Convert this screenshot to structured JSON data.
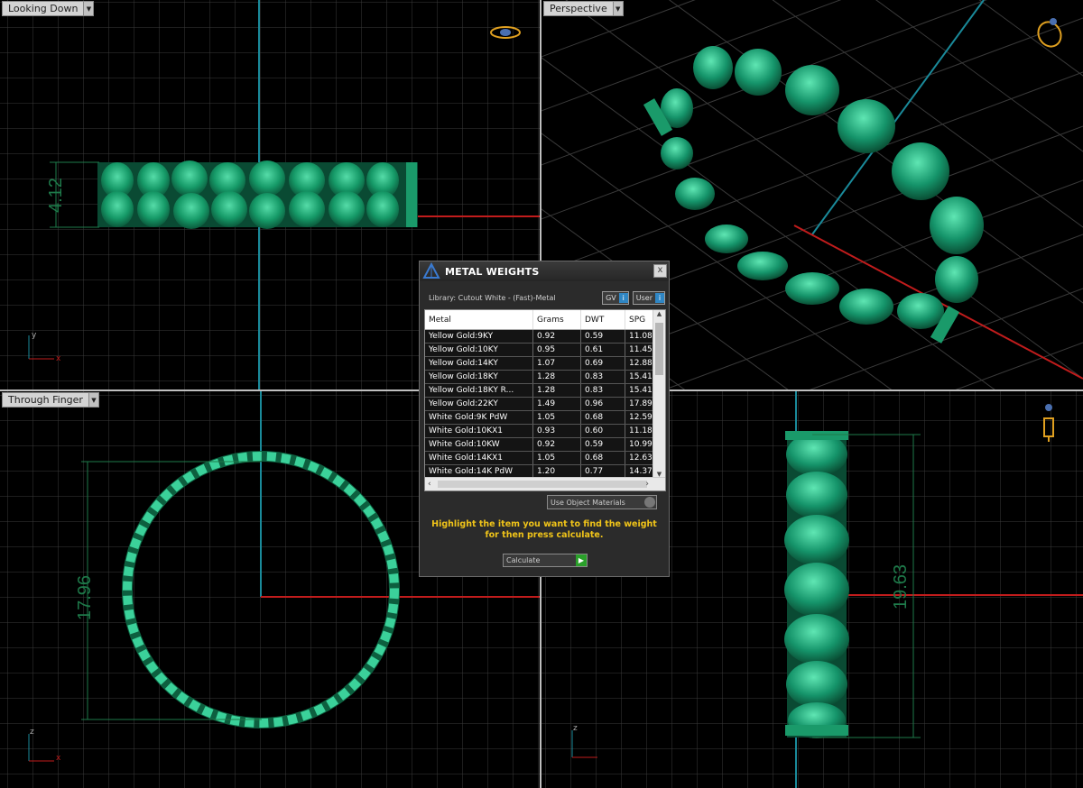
{
  "viewports": {
    "top": {
      "label": "Looking Down",
      "dimension": "4.12"
    },
    "perspective": {
      "label": "Perspective"
    },
    "finger": {
      "label": "Through Finger",
      "dimension": "17.96"
    },
    "side": {
      "dimension": "19.63"
    }
  },
  "axes": {
    "y": "y",
    "x": "x",
    "z": "z"
  },
  "dialog": {
    "title": "METAL WEIGHTS",
    "close": "x",
    "library": "Library: Cutout White - (Fast)-Metal",
    "toggle_gv": "GV",
    "toggle_user": "User",
    "toggle_key": "i",
    "columns": [
      "Metal",
      "Grams",
      "DWT",
      "SPG"
    ],
    "rows": [
      {
        "metal": "Yellow Gold:9KY",
        "grams": "0.92",
        "dwt": "0.59",
        "spg": "11.08"
      },
      {
        "metal": "Yellow Gold:10KY",
        "grams": "0.95",
        "dwt": "0.61",
        "spg": "11.45"
      },
      {
        "metal": "Yellow Gold:14KY",
        "grams": "1.07",
        "dwt": "0.69",
        "spg": "12.88"
      },
      {
        "metal": "Yellow Gold:18KY",
        "grams": "1.28",
        "dwt": "0.83",
        "spg": "15.41"
      },
      {
        "metal": "Yellow Gold:18KY R...",
        "grams": "1.28",
        "dwt": "0.83",
        "spg": "15.41"
      },
      {
        "metal": "Yellow Gold:22KY",
        "grams": "1.49",
        "dwt": "0.96",
        "spg": "17.89"
      },
      {
        "metal": "White Gold:9K PdW",
        "grams": "1.05",
        "dwt": "0.68",
        "spg": "12.59"
      },
      {
        "metal": "White Gold:10KX1",
        "grams": "0.93",
        "dwt": "0.60",
        "spg": "11.18"
      },
      {
        "metal": "White Gold:10KW",
        "grams": "0.92",
        "dwt": "0.59",
        "spg": "10.99"
      },
      {
        "metal": "White Gold:14KX1",
        "grams": "1.05",
        "dwt": "0.68",
        "spg": "12.63"
      },
      {
        "metal": "White Gold:14K PdW",
        "grams": "1.20",
        "dwt": "0.77",
        "spg": "14.37"
      }
    ],
    "use_object_materials": "Use Object Materials",
    "hint_line1": "Highlight the item you want to find the weight",
    "hint_line2": "for then press calculate.",
    "calculate": "Calculate",
    "calculate_key": "▶"
  },
  "colors": {
    "grid": "#3a3a3a",
    "gem_green": "#1a9a6a",
    "axis_red": "#c11c1c",
    "axis_cyan": "#1a8a9a",
    "dialog_hint": "#f0c419"
  }
}
